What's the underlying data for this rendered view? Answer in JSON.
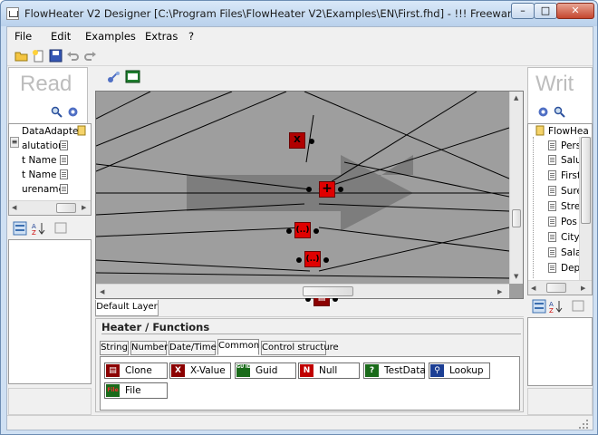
{
  "window": {
    "title": "FlowHeater V2 Designer [C:\\Program Files\\FlowHeater V2\\Examples\\EN\\First.fhd] - !!! Freeware Version !!!",
    "buttons": {
      "minimize": "–",
      "maximize": "□",
      "close": "✕"
    }
  },
  "menu": [
    "File",
    "Edit",
    "Examples",
    "Extras",
    "?"
  ],
  "toolbar_icons": [
    "open-icon",
    "new-icon",
    "save-icon",
    "undo-icon",
    "redo-icon"
  ],
  "read_panel": {
    "title": "Read",
    "adapter": "DataAdapter",
    "fields": [
      "alutation",
      "t Name",
      "t Name",
      "urename"
    ]
  },
  "write_panel": {
    "title": "Writ",
    "adapter": "FlowHea",
    "fields": [
      "Pers",
      "Salu",
      "First",
      "Sure",
      "Stre",
      "Pos",
      "City",
      "Sala",
      "Dep"
    ]
  },
  "canvas": {
    "layer_tab": "Default Layer",
    "nodes": [
      "X",
      "+",
      "(..)",
      "(..)",
      ""
    ]
  },
  "functions": {
    "header": "Heater / Functions",
    "tabs": [
      "String",
      "Number",
      "Date/Time",
      "Common",
      "Control structure"
    ],
    "active_tab": "Common",
    "buttons": [
      {
        "label": "Clone",
        "icon": "clone-icon",
        "glyph": "▤"
      },
      {
        "label": "X-Value",
        "icon": "x-value-icon",
        "glyph": "X"
      },
      {
        "label": "Guid",
        "icon": "guid-icon",
        "glyph": "GU ID"
      },
      {
        "label": "Null",
        "icon": "null-icon",
        "glyph": "N"
      },
      {
        "label": "TestData",
        "icon": "testdata-icon",
        "glyph": "?"
      },
      {
        "label": "Lookup",
        "icon": "lookup-icon",
        "glyph": "⚲"
      },
      {
        "label": "File",
        "icon": "file-icon",
        "glyph": "File"
      }
    ]
  },
  "colors": {
    "node": "#e00000",
    "canvas": "#9e9e9e",
    "function_icon": "#8b0000"
  }
}
